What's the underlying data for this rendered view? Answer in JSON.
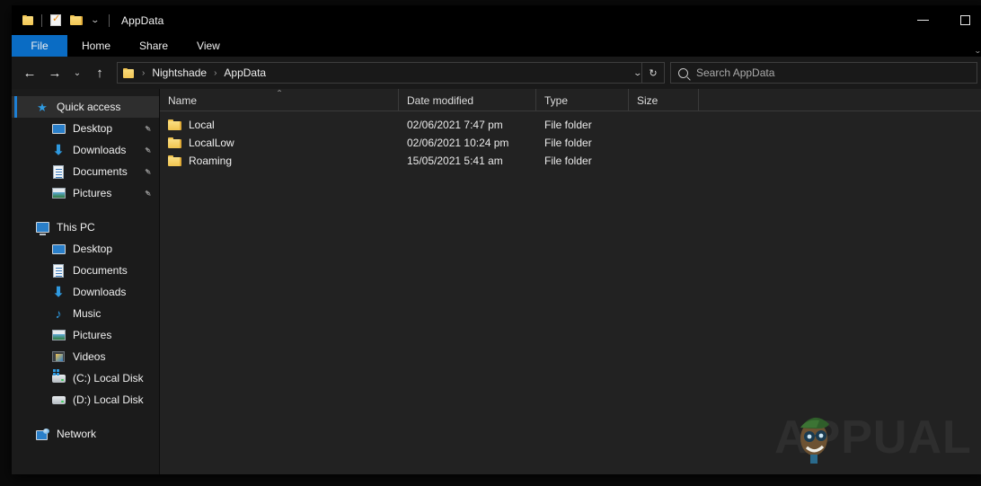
{
  "window": {
    "title": "AppData",
    "quick_access_toolbar": [
      {
        "name": "folder-icon",
        "label": ""
      },
      {
        "name": "properties-icon",
        "label": ""
      },
      {
        "name": "new-folder-icon",
        "label": ""
      },
      {
        "name": "customize-chevron-icon",
        "label": "⌄"
      }
    ],
    "controls": {
      "minimize": "minimize-button",
      "maximize": "maximize-button"
    }
  },
  "ribbon": {
    "tabs": [
      {
        "label": "File",
        "active": true
      },
      {
        "label": "Home",
        "active": false
      },
      {
        "label": "Share",
        "active": false
      },
      {
        "label": "View",
        "active": false
      }
    ],
    "expand_icon": "⌄"
  },
  "address_bar": {
    "back_icon": "←",
    "forward_icon": "→",
    "recent_icon": "⌄",
    "up_icon": "↑",
    "breadcrumb": [
      "Nightshade",
      "AppData"
    ],
    "breadcrumb_separator": "›",
    "dropdown_icon": "⌄",
    "refresh_icon": "↻"
  },
  "search": {
    "placeholder": "Search AppData",
    "value": "",
    "icon": "search-icon"
  },
  "sidebar": {
    "groups": [
      {
        "header": {
          "label": "Quick access",
          "icon": "star-icon",
          "selected": true
        },
        "items": [
          {
            "label": "Desktop",
            "icon": "monitor-icon",
            "pinned": true
          },
          {
            "label": "Downloads",
            "icon": "download-icon",
            "pinned": true
          },
          {
            "label": "Documents",
            "icon": "document-icon",
            "pinned": true
          },
          {
            "label": "Pictures",
            "icon": "picture-icon",
            "pinned": true
          }
        ]
      },
      {
        "header": {
          "label": "This PC",
          "icon": "pc-icon",
          "selected": false
        },
        "items": [
          {
            "label": "Desktop",
            "icon": "monitor-icon",
            "pinned": false
          },
          {
            "label": "Documents",
            "icon": "document-icon",
            "pinned": false
          },
          {
            "label": "Downloads",
            "icon": "download-icon",
            "pinned": false
          },
          {
            "label": "Music",
            "icon": "music-icon",
            "pinned": false
          },
          {
            "label": "Pictures",
            "icon": "picture-icon",
            "pinned": false
          },
          {
            "label": "Videos",
            "icon": "video-icon",
            "pinned": false
          },
          {
            "label": "(C:) Local Disk",
            "icon": "system-drive-icon",
            "pinned": false
          },
          {
            "label": "(D:) Local Disk",
            "icon": "drive-icon",
            "pinned": false
          }
        ]
      },
      {
        "header": {
          "label": "Network",
          "icon": "network-icon",
          "selected": false
        },
        "items": []
      }
    ],
    "pin_icon": "📌"
  },
  "file_list": {
    "columns": [
      {
        "label": "Name",
        "sorted": "asc",
        "sort_icon": "⌃"
      },
      {
        "label": "Date modified",
        "sorted": "",
        "sort_icon": ""
      },
      {
        "label": "Type",
        "sorted": "",
        "sort_icon": ""
      },
      {
        "label": "Size",
        "sorted": "",
        "sort_icon": ""
      }
    ],
    "rows": [
      {
        "name": "Local",
        "date_modified": "02/06/2021 7:47 pm",
        "type": "File folder",
        "size": ""
      },
      {
        "name": "LocalLow",
        "date_modified": "02/06/2021 10:24 pm",
        "type": "File folder",
        "size": ""
      },
      {
        "name": "Roaming",
        "date_modified": "15/05/2021 5:41 am",
        "type": "File folder",
        "size": ""
      }
    ]
  },
  "watermark": {
    "text": "APPUALS"
  },
  "colors": {
    "accent": "#0a6cc4",
    "selection_bar": "#1d7fd4",
    "folder_yellow": "#f1c44f",
    "window_bg": "#191919",
    "sidebar_bg": "#1b1b1b",
    "content_bg": "#222222"
  }
}
